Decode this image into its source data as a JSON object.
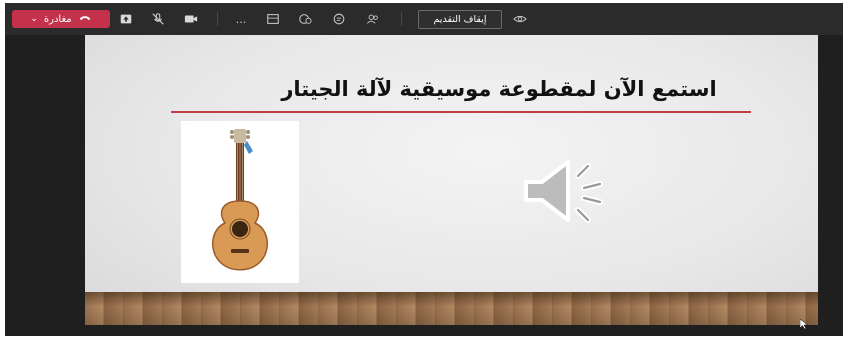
{
  "toolbar": {
    "leave_label": "مغادرة",
    "stop_presenting_label": "إيقاف التقديم",
    "more_label": "...",
    "icons": [
      "chevron-down-icon",
      "phone-icon",
      "share-tray-icon",
      "mic-off-icon",
      "camera-icon",
      "more-icon",
      "view-icon",
      "reactions-icon",
      "chat-icon",
      "participants-icon",
      "eye-icon"
    ]
  },
  "slide": {
    "title": "استمع الآن لمقطوعة موسيقية لآلة الجيتار",
    "accent_color": "#c23b47"
  },
  "colors": {
    "leave_button": "#c4314b",
    "toolbar_bg": "#2b2b2b",
    "stage_bg": "#201f1f"
  }
}
